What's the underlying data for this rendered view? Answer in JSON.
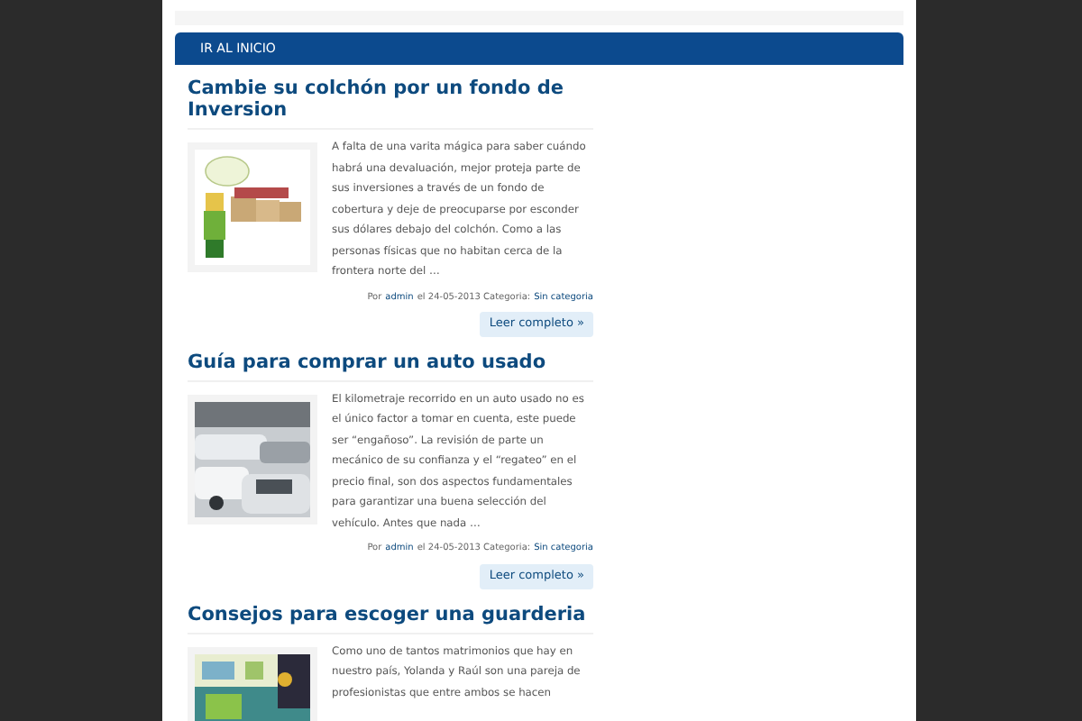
{
  "nav": {
    "label": "IR AL INICIO"
  },
  "posts": [
    {
      "title": "Cambie su colchón por un fondo de Inversion",
      "excerpt": "A falta de una varita mágica para saber cuándo habrá una devaluación, mejor proteja parte de sus inversiones a través de un fondo de cobertura y deje de preocuparse por esconder sus dólares debajo del colchón. Como a las personas físicas que no habitan cerca de la frontera norte del …",
      "meta": {
        "by": "Por",
        "author": "admin",
        "date": "el 24-05-2013 Categoria:",
        "category": "Sin categoria"
      },
      "more": "Leer completo »"
    },
    {
      "title": "Guía para comprar un auto usado",
      "excerpt": "El kilometraje recorrido en un auto usado no es el único factor a tomar en cuenta, este puede ser “engañoso”. La revisión de parte un mecánico de su confianza y el “regateo” en el precio final, son dos aspectos fundamentales para garantizar una buena selección del vehículo. Antes que nada …",
      "meta": {
        "by": "Por",
        "author": "admin",
        "date": "el 24-05-2013 Categoria:",
        "category": "Sin categoria"
      },
      "more": "Leer completo »"
    },
    {
      "title": "Consejos para escoger una guarderia",
      "excerpt": "Como uno de tantos matrimonios que hay en nuestro país, Yolanda y Raúl son una pareja de profesionistas que entre ambos se hacen"
    }
  ]
}
